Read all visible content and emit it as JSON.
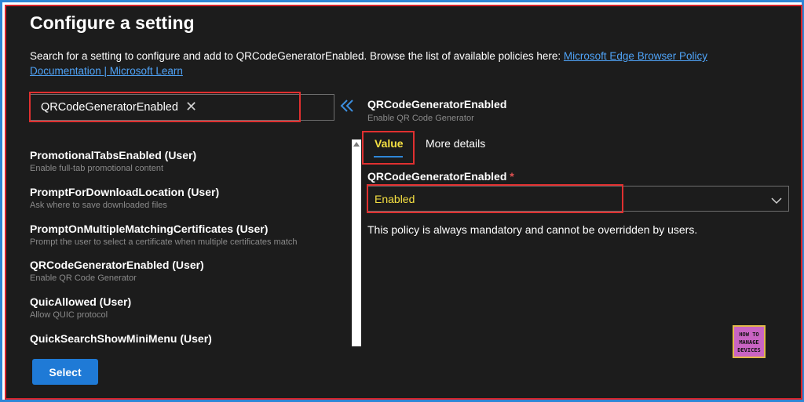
{
  "dialog": {
    "title": "Configure a setting",
    "description": "Search for a setting to configure and add to QRCodeGeneratorEnabled. Browse the list of available policies here: ",
    "link_text": "Microsoft Edge Browser Policy Documentation | Microsoft Learn"
  },
  "search": {
    "value": "QRCodeGeneratorEnabled",
    "clear_icon": "close-icon"
  },
  "settings_list": [
    {
      "name": "PromotionalTabsEnabled (User)",
      "description": "Enable full-tab promotional content"
    },
    {
      "name": "PromptForDownloadLocation (User)",
      "description": "Ask where to save downloaded files"
    },
    {
      "name": "PromptOnMultipleMatchingCertificates (User)",
      "description": "Prompt the user to select a certificate when multiple certificates match"
    },
    {
      "name": "QRCodeGeneratorEnabled (User)",
      "description": "Enable QR Code Generator"
    },
    {
      "name": "QuicAllowed (User)",
      "description": "Allow QUIC protocol"
    },
    {
      "name": "QuickSearchShowMiniMenu (User)",
      "description": ""
    }
  ],
  "select_button": "Select",
  "detail": {
    "title": "QRCodeGeneratorEnabled",
    "subtitle": "Enable QR Code Generator",
    "tabs": [
      {
        "label": "Value",
        "active": true
      },
      {
        "label": "More details",
        "active": false
      }
    ],
    "field_label": "QRCodeGeneratorEnabled",
    "required_marker": "*",
    "dropdown_value": "Enabled",
    "note": "This policy is always mandatory and cannot be overridden by users."
  },
  "logo": {
    "line1": "HOW TO",
    "line2": "MANAGE",
    "line3": "DEVICES"
  },
  "colors": {
    "background": "#1c1c1c",
    "accent": "#1f7ad6",
    "highlight_border": "#e03030",
    "highlight_text": "#f5e042"
  }
}
